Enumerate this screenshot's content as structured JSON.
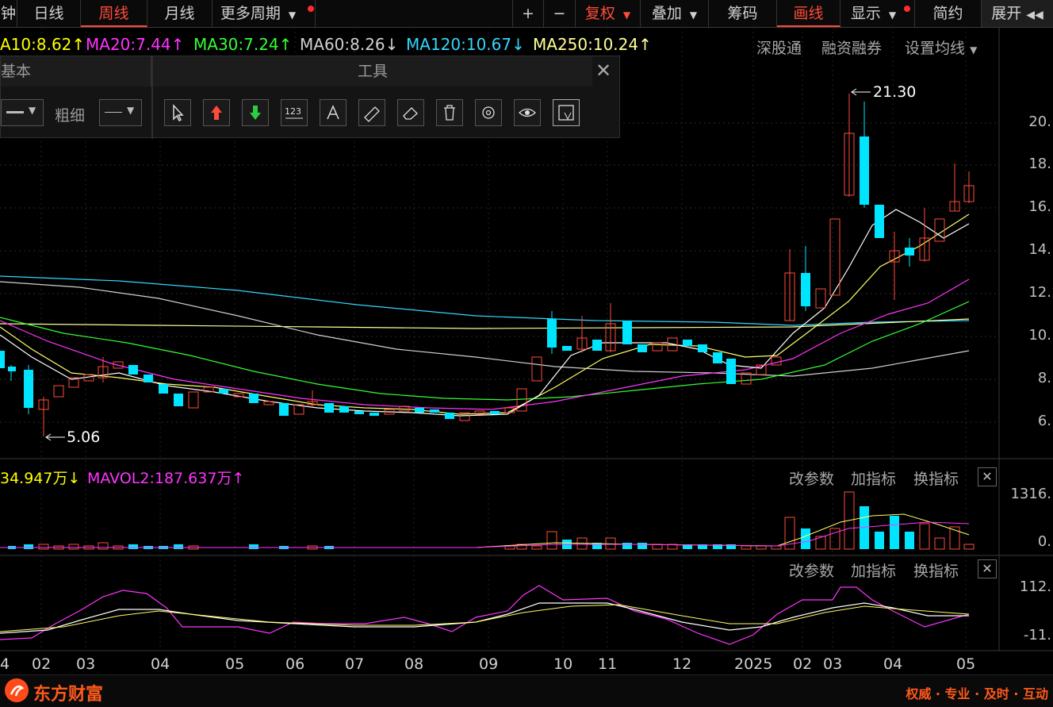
{
  "top_tabs": [
    {
      "label": "钟",
      "active": false
    },
    {
      "label": "日线",
      "active": false
    },
    {
      "label": "周线",
      "active": true
    },
    {
      "label": "月线",
      "active": false
    },
    {
      "label": "更多周期",
      "active": false
    }
  ],
  "top_right": {
    "plus": "+",
    "minus": "−",
    "fuquan": "复权",
    "diejia": "叠加",
    "chouma": "筹码",
    "huaxian": "画线",
    "xianshi": "显示",
    "jianyue": "简约",
    "zhankai": "展开"
  },
  "ma_line": [
    {
      "label": "A10:8.62",
      "arrow": "↑",
      "color": "#ffff00"
    },
    {
      "label": "MA20:7.44",
      "arrow": "↑",
      "color": "#ff33ff"
    },
    {
      "label": "MA30:7.24",
      "arrow": "↑",
      "color": "#33ff33"
    },
    {
      "label": "MA60:8.26",
      "arrow": "↓",
      "color": "#d0d0d0"
    },
    {
      "label": "MA120:10.67",
      "arrow": "↓",
      "color": "#33d6ff"
    },
    {
      "label": "MA250:10.24",
      "arrow": "↑",
      "color": "#ffff99"
    }
  ],
  "ma_right_links": {
    "shengutong": "深股通",
    "rongzi": "融资融券",
    "shezhi": "设置均线"
  },
  "draw_panel": {
    "title_left": "基本",
    "title_tools": "工具",
    "thickness_label": "粗细",
    "tools": [
      "cursor-icon",
      "up-arrow-icon",
      "down-arrow-icon",
      "number-icon",
      "text-icon",
      "ruler-icon",
      "eraser-icon",
      "trash-icon",
      "gear-icon",
      "eye-icon",
      "magnet-icon"
    ]
  },
  "annotations": {
    "high": "21.30",
    "low": "5.06"
  },
  "price_axis": [
    "20.",
    "18.",
    "16.",
    "14.",
    "12.",
    "10.",
    "8.",
    "6."
  ],
  "vol_panel": {
    "mavol1": "34.947万",
    "mavol1_arrow": "↓",
    "mavol2": "MAVOL2:187.637万",
    "mavol2_arrow": "↑",
    "axis_top": "1316.",
    "axis_bottom": "0.",
    "btn_params": "改参数",
    "btn_add": "加指标",
    "btn_switch": "换指标"
  },
  "ind_panel": {
    "axis_top": "112.",
    "axis_bottom": "-11.",
    "btn_params": "改参数",
    "btn_add": "加指标",
    "btn_switch": "换指标"
  },
  "x_axis": [
    "4",
    "02",
    "03",
    "04",
    "05",
    "06",
    "07",
    "08",
    "09",
    "10",
    "11",
    "12",
    "2025",
    "02",
    "03",
    "04",
    "05"
  ],
  "footer": {
    "brand": "东方财富",
    "slogan": "权威 · 专业 · 及时 · 互动"
  },
  "colors": {
    "up": "#ff4b3a",
    "down": "#00e5ff",
    "accent": "#ff4b3a"
  }
}
